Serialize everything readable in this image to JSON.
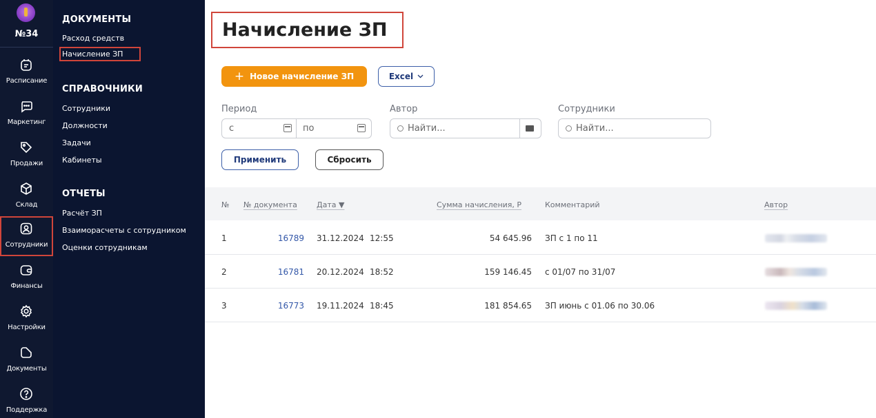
{
  "rail": {
    "org_number": "№34",
    "items": [
      {
        "label": "Расписание",
        "icon": "calendar-icon"
      },
      {
        "label": "Маркетинг",
        "icon": "chat-icon"
      },
      {
        "label": "Продажи",
        "icon": "tag-icon"
      },
      {
        "label": "Склад",
        "icon": "box-icon"
      },
      {
        "label": "Сотрудники",
        "icon": "employee-icon"
      },
      {
        "label": "Финансы",
        "icon": "wallet-icon"
      },
      {
        "label": "Настройки",
        "icon": "gear-icon"
      },
      {
        "label": "Документы",
        "icon": "document-icon"
      },
      {
        "label": "Поддержка",
        "icon": "help-icon"
      }
    ]
  },
  "menu": {
    "documents_title": "ДОКУМЕНТЫ",
    "documents": [
      "Расход средств",
      "Начисление ЗП"
    ],
    "references_title": "СПРАВОЧНИКИ",
    "references": [
      "Сотрудники",
      "Должности",
      "Задачи",
      "Кабинеты"
    ],
    "reports_title": "ОТЧЕТЫ",
    "reports": [
      "Расчёт ЗП",
      "Взаиморасчеты с сотрудником",
      "Оценки сотрудникам"
    ]
  },
  "page": {
    "title": "Начисление ЗП",
    "new_button": "Новое начисление ЗП",
    "excel_button": "Excel"
  },
  "filters": {
    "period_label": "Период",
    "from_placeholder": "с",
    "to_placeholder": "по",
    "author_label": "Автор",
    "author_placeholder": "Найти...",
    "employees_label": "Сотрудники",
    "employees_placeholder": "Найти...",
    "apply": "Применить",
    "reset": "Сбросить"
  },
  "table": {
    "headers": {
      "n": "№",
      "doc": "№ документа",
      "date": "Дата ▼",
      "sum": "Сумма начисления, Р",
      "comment": "Комментарий",
      "author": "Автор"
    },
    "rows": [
      {
        "n": "1",
        "doc": "16789",
        "date": "31.12.2024",
        "time": "12:55",
        "sum": "54 645.96",
        "comment": "ЗП с 1 по 11"
      },
      {
        "n": "2",
        "doc": "16781",
        "date": "20.12.2024",
        "time": "18:52",
        "sum": "159 146.45",
        "comment": "с 01/07 по 31/07"
      },
      {
        "n": "3",
        "doc": "16773",
        "date": "19.11.2024",
        "time": "18:45",
        "sum": "181 854.65",
        "comment": "ЗП июнь с 01.06 по 30.06"
      }
    ]
  },
  "colors": {
    "accent_orange": "#f2940f",
    "sidebar_bg": "#0f1830",
    "highlight_red": "#d0453a",
    "link_blue": "#3357a8"
  }
}
